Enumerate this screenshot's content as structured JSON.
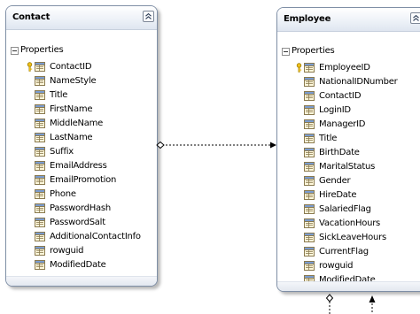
{
  "entities": {
    "contact": {
      "title": "Contact",
      "section": "Properties",
      "properties": [
        "ContactID",
        "NameStyle",
        "Title",
        "FirstName",
        "MiddleName",
        "LastName",
        "Suffix",
        "EmailAddress",
        "EmailPromotion",
        "Phone",
        "PasswordHash",
        "PasswordSalt",
        "AdditionalContactInfo",
        "rowguid",
        "ModifiedDate"
      ],
      "key_property": "ContactID"
    },
    "employee": {
      "title": "Employee",
      "section": "Properties",
      "properties": [
        "EmployeeID",
        "NationalIDNumber",
        "ContactID",
        "LoginID",
        "ManagerID",
        "Title",
        "BirthDate",
        "MaritalStatus",
        "Gender",
        "HireDate",
        "SalariedFlag",
        "VacationHours",
        "SickLeaveHours",
        "CurrentFlag",
        "rowguid",
        "ModifiedDate"
      ],
      "key_property": "EmployeeID"
    }
  },
  "icons": {
    "property": "property-icon",
    "key": "key-icon",
    "collapse": "collapse-chevron-icon",
    "section_toggle": "section-collapse-icon"
  },
  "colors": {
    "border": "#7f8fa6",
    "header_gradient_end": "#dfe6f0",
    "connector": "#000000",
    "key": "#e8b400"
  }
}
